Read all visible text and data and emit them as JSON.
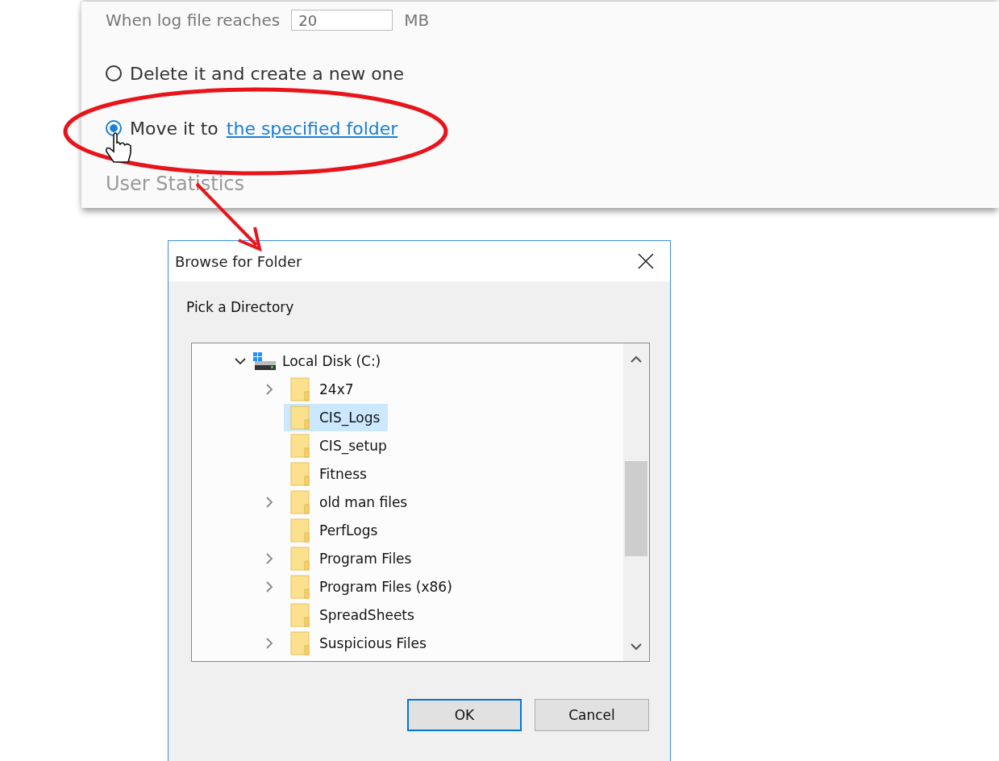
{
  "settings_panel": {
    "log_size_row": {
      "label": "When log file reaches",
      "value": "20",
      "unit": "MB"
    },
    "options": [
      {
        "label": "Delete it and create a new one",
        "selected": false
      },
      {
        "label": "Move it to",
        "link": "the specified folder",
        "selected": true
      }
    ],
    "section_heading": "User Statistics"
  },
  "dialog": {
    "title": "Browse for Folder",
    "prompt": "Pick a Directory",
    "tree": {
      "label": "Local Disk (C:)",
      "expanded": true,
      "children": [
        {
          "label": "24x7",
          "expandable": true,
          "selected": false
        },
        {
          "label": "CIS_Logs",
          "expandable": false,
          "selected": true
        },
        {
          "label": "CIS_setup",
          "expandable": false,
          "selected": false
        },
        {
          "label": "Fitness",
          "expandable": false,
          "selected": false
        },
        {
          "label": "old man files",
          "expandable": true,
          "selected": false
        },
        {
          "label": "PerfLogs",
          "expandable": false,
          "selected": false
        },
        {
          "label": "Program Files",
          "expandable": true,
          "selected": false
        },
        {
          "label": "Program Files (x86)",
          "expandable": true,
          "selected": false
        },
        {
          "label": "SpreadSheets",
          "expandable": false,
          "selected": false
        },
        {
          "label": "Suspicious Files",
          "expandable": true,
          "selected": false
        }
      ]
    },
    "buttons": [
      {
        "label": "OK",
        "default": true
      },
      {
        "label": "Cancel",
        "default": false
      }
    ]
  }
}
